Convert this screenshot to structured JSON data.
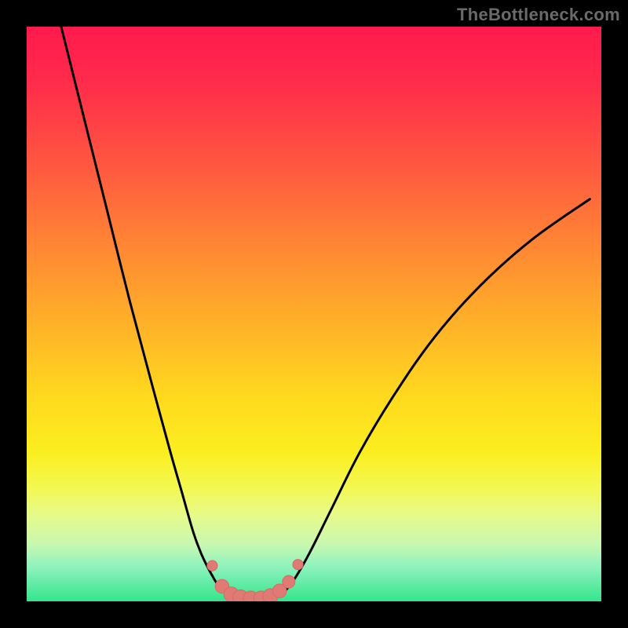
{
  "watermark": "TheBottleneck.com",
  "colors": {
    "frame": "#000000",
    "curve": "#000000",
    "marker_fill": "#e07a74",
    "marker_stroke": "#d96a64",
    "gradient_top": "#ff1a4d",
    "gradient_bottom": "#34e58c"
  },
  "chart_data": {
    "type": "line",
    "title": "",
    "xlabel": "",
    "ylabel": "",
    "xlim": [
      0,
      100
    ],
    "ylim": [
      0,
      100
    ],
    "grid": false,
    "legend": false,
    "series": [
      {
        "name": "left-branch",
        "x": [
          6,
          10,
          14,
          18,
          22,
          25,
          27,
          29,
          30.5,
          32,
          33.5,
          35
        ],
        "y": [
          100,
          84,
          68,
          52,
          37,
          26,
          19,
          12,
          8,
          5,
          2.5,
          1
        ]
      },
      {
        "name": "right-branch",
        "x": [
          44,
          46,
          49,
          53,
          58,
          64,
          71,
          79,
          88,
          98
        ],
        "y": [
          1,
          3,
          8,
          16,
          26,
          36,
          46,
          55,
          63,
          70
        ]
      }
    ],
    "markers": {
      "name": "bottom-cluster",
      "points": [
        {
          "x": 32.3,
          "y": 6.2,
          "r": 0.9
        },
        {
          "x": 34.0,
          "y": 2.6,
          "r": 1.2
        },
        {
          "x": 35.6,
          "y": 1.2,
          "r": 1.3
        },
        {
          "x": 37.2,
          "y": 0.7,
          "r": 1.3
        },
        {
          "x": 39.0,
          "y": 0.5,
          "r": 1.3
        },
        {
          "x": 40.8,
          "y": 0.5,
          "r": 1.3
        },
        {
          "x": 42.4,
          "y": 0.9,
          "r": 1.3
        },
        {
          "x": 44.0,
          "y": 1.8,
          "r": 1.2
        },
        {
          "x": 45.6,
          "y": 3.4,
          "r": 1.1
        },
        {
          "x": 47.2,
          "y": 6.4,
          "r": 0.9
        }
      ]
    }
  }
}
